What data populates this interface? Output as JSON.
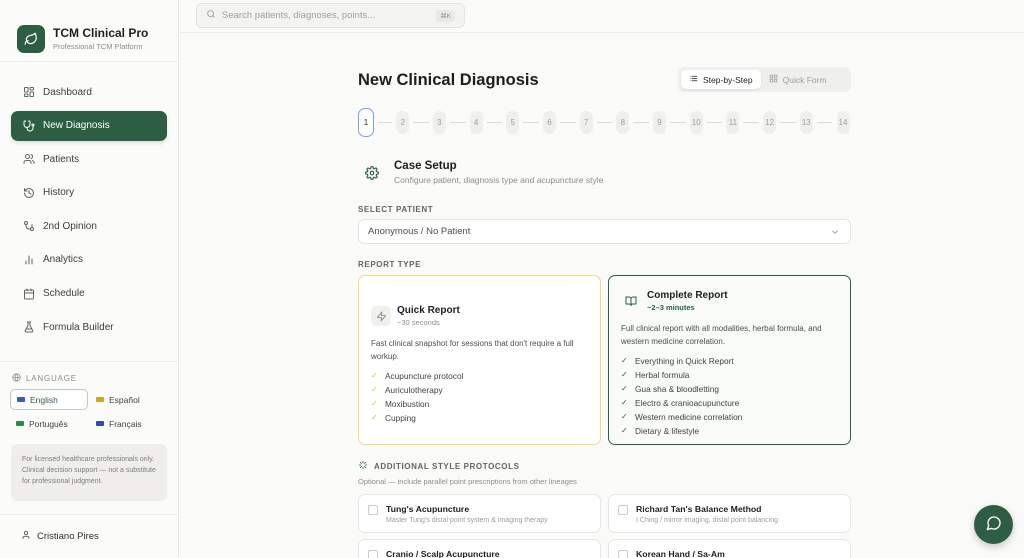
{
  "brand": {
    "name": "TCM Clinical Pro",
    "subtitle": "Professional TCM Platform"
  },
  "search": {
    "placeholder": "Search patients, diagnoses, points...",
    "shortcut": "⌘K"
  },
  "nav": [
    {
      "label": "Dashboard",
      "icon": "dashboard-icon",
      "active": false
    },
    {
      "label": "New Diagnosis",
      "icon": "stethoscope-icon",
      "active": true
    },
    {
      "label": "Patients",
      "icon": "users-icon",
      "active": false
    },
    {
      "label": "History",
      "icon": "history-icon",
      "active": false
    },
    {
      "label": "2nd Opinion",
      "icon": "branch-icon",
      "active": false
    },
    {
      "label": "Analytics",
      "icon": "bar-chart-icon",
      "active": false
    },
    {
      "label": "Schedule",
      "icon": "calendar-icon",
      "active": false
    },
    {
      "label": "Formula Builder",
      "icon": "flask-icon",
      "active": false
    }
  ],
  "language": {
    "title": "LANGUAGE",
    "options": [
      {
        "label": "English",
        "active": true,
        "flag": "#3b5ab7"
      },
      {
        "label": "Español",
        "active": false,
        "flag": "#d4a21c"
      },
      {
        "label": "Português",
        "active": false,
        "flag": "#2f8a48"
      },
      {
        "label": "Français",
        "active": false,
        "flag": "#2b4fa8"
      }
    ]
  },
  "disclaimer": "For licensed healthcare professionals only. Clinical decision support — not a substitute for professional judgment.",
  "user": {
    "name": "Cristiano Pires"
  },
  "page": {
    "title": "New Clinical Diagnosis"
  },
  "mode_toggle": {
    "step_label": "Step-by-Step",
    "quick_label": "Quick Form",
    "active": "step"
  },
  "steps": [
    "1",
    "2",
    "3",
    "4",
    "5",
    "6",
    "7",
    "8",
    "9",
    "10",
    "11",
    "12",
    "13",
    "14"
  ],
  "current_step": 1,
  "section": {
    "title": "Case Setup",
    "subtitle": "Configure patient, diagnosis type and acupuncture style"
  },
  "patient": {
    "label": "SELECT PATIENT",
    "value": "Anonymous / No Patient"
  },
  "report_type": {
    "label": "REPORT TYPE",
    "quick": {
      "title": "Quick Report",
      "duration": "~30 seconds",
      "description": "Fast clinical snapshot for sessions that don't require a full workup.",
      "features": [
        "Acupuncture protocol",
        "Auriculotherapy",
        "Moxibustion",
        "Cupping"
      ]
    },
    "complete": {
      "title": "Complete Report",
      "duration": "~2–3 minutes",
      "description": "Full clinical report with all modalities, herbal formula, and western medicine correlation.",
      "features": [
        "Everything in Quick Report",
        "Herbal formula",
        "Gua sha & bloodletting",
        "Electro & cranioacupuncture",
        "Western medicine correlation",
        "Dietary & lifestyle"
      ],
      "selected": true
    }
  },
  "protocols": {
    "title": "ADDITIONAL STYLE PROTOCOLS",
    "subtitle": "Optional — include parallel point prescriptions from other lineages",
    "items": [
      {
        "title": "Tung's Acupuncture",
        "subtitle": "Master Tung's distal point system & imaging therapy"
      },
      {
        "title": "Richard Tan's Balance Method",
        "subtitle": "I Ching / mirror imaging, distal point balancing"
      },
      {
        "title": "Cranio / Scalp Acupuncture",
        "subtitle": ""
      },
      {
        "title": "Korean Hand / Sa-Am",
        "subtitle": ""
      }
    ]
  },
  "colors": {
    "accent": "#2d5e43",
    "quick_border": "#f2d97a",
    "step_active_border": "#7aa0de"
  }
}
